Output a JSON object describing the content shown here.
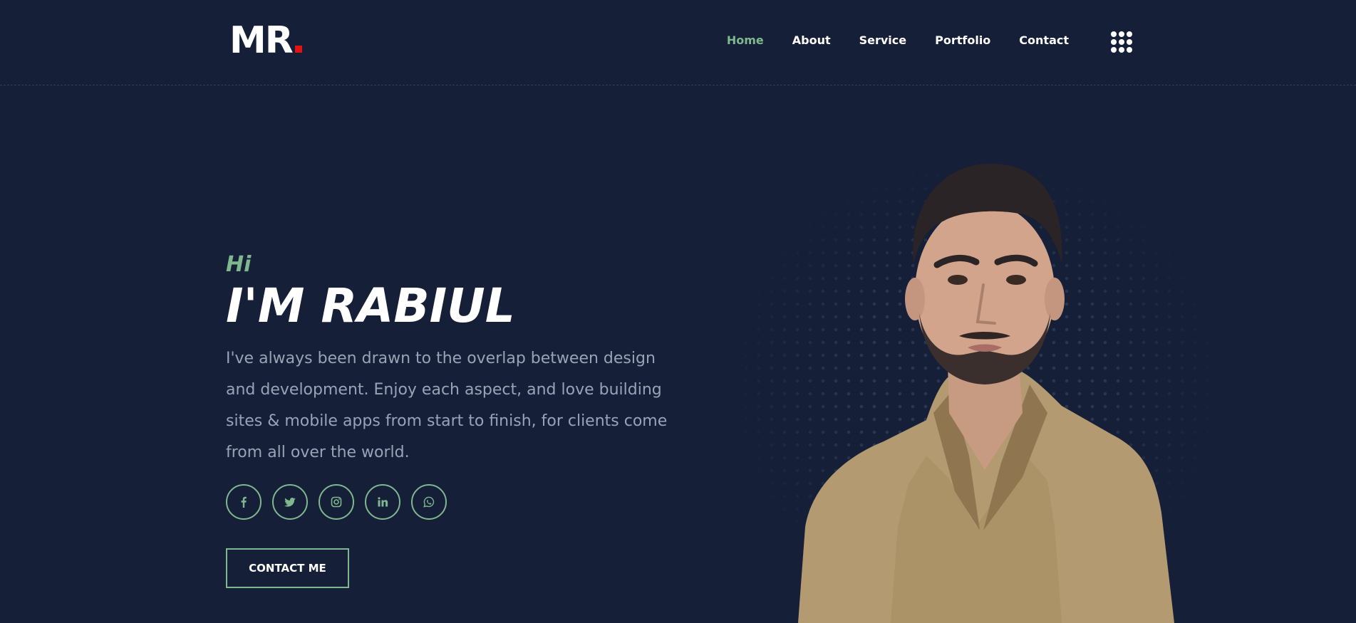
{
  "header": {
    "logo_text": "MR",
    "nav": [
      {
        "label": "Home"
      },
      {
        "label": "About"
      },
      {
        "label": "Service"
      },
      {
        "label": "Portfolio"
      },
      {
        "label": "Contact"
      }
    ],
    "menu_icon": "grid-dots-icon"
  },
  "hero": {
    "greeting": "Hi",
    "name": "I'M RABIUL",
    "bio": "I've always been drawn to the overlap between design and development. Enjoy each aspect, and love building sites & mobile apps from start to finish, for clients come from all over the world.",
    "socials": [
      {
        "icon": "facebook-icon"
      },
      {
        "icon": "twitter-icon"
      },
      {
        "icon": "instagram-icon"
      },
      {
        "icon": "linkedin-icon"
      },
      {
        "icon": "whatsapp-icon"
      }
    ],
    "cta_label": "CONTACT ME"
  },
  "colors": {
    "background": "#151f37",
    "accent": "#7fb88e",
    "logo_dot": "#e11414",
    "text_muted": "#9aa3b5"
  }
}
